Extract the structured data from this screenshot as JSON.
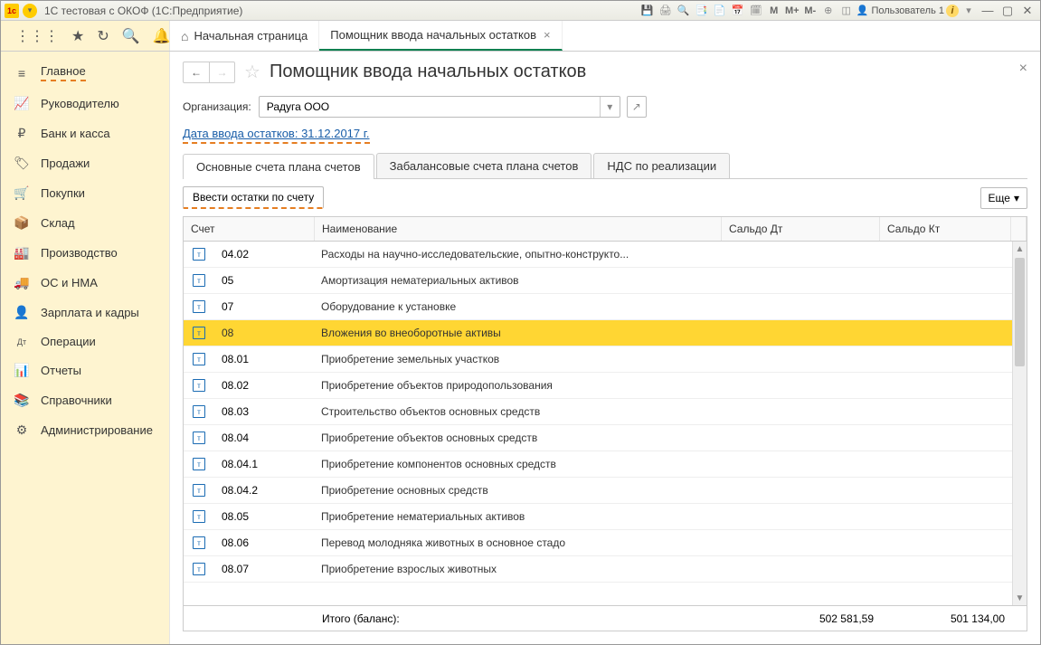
{
  "titlebar": {
    "title": "1С тестовая с ОКОФ (1С:Предприятие)",
    "user": "Пользователь 1",
    "icons": {
      "m": "M",
      "m_plus": "M+",
      "m_minus": "M-"
    }
  },
  "tabs": {
    "home": "Начальная страница",
    "current": "Помощник ввода начальных остатков"
  },
  "sidebar": [
    {
      "icon": "≡",
      "label": "Главное",
      "active": true
    },
    {
      "icon": "📈",
      "label": "Руководителю"
    },
    {
      "icon": "₽",
      "label": "Банк и касса"
    },
    {
      "icon": "🏷",
      "label": "Продажи"
    },
    {
      "icon": "🛒",
      "label": "Покупки"
    },
    {
      "icon": "📦",
      "label": "Склад"
    },
    {
      "icon": "🏭",
      "label": "Производство"
    },
    {
      "icon": "🚚",
      "label": "ОС и НМА"
    },
    {
      "icon": "👤",
      "label": "Зарплата и кадры"
    },
    {
      "icon": "Дт",
      "label": "Операции"
    },
    {
      "icon": "📊",
      "label": "Отчеты"
    },
    {
      "icon": "📚",
      "label": "Справочники"
    },
    {
      "icon": "⚙",
      "label": "Администрирование"
    }
  ],
  "page": {
    "title": "Помощник ввода начальных остатков",
    "org_label": "Организация:",
    "org_value": "Радуга ООО",
    "date_link": "Дата ввода остатков: 31.12.2017 г.",
    "inner_tabs": [
      "Основные счета плана счетов",
      "Забалансовые счета плана счетов",
      "НДС по реализации"
    ],
    "enter_balances_btn": "Ввести остатки по счету",
    "more_btn": "Еще",
    "columns": {
      "account": "Счет",
      "name": "Наименование",
      "saldo_dt": "Сальдо Дт",
      "saldo_kt": "Сальдо Кт"
    },
    "rows": [
      {
        "acct": "04.02",
        "name": "Расходы на научно-исследовательские, опытно-конструкто..."
      },
      {
        "acct": "05",
        "name": "Амортизация нематериальных активов"
      },
      {
        "acct": "07",
        "name": "Оборудование к установке"
      },
      {
        "acct": "08",
        "name": "Вложения во внеоборотные активы",
        "selected": true
      },
      {
        "acct": "08.01",
        "name": "Приобретение земельных участков"
      },
      {
        "acct": "08.02",
        "name": "Приобретение объектов природопользования"
      },
      {
        "acct": "08.03",
        "name": "Строительство объектов основных средств"
      },
      {
        "acct": "08.04",
        "name": "Приобретение объектов основных средств"
      },
      {
        "acct": "08.04.1",
        "name": "Приобретение компонентов основных средств"
      },
      {
        "acct": "08.04.2",
        "name": "Приобретение основных средств"
      },
      {
        "acct": "08.05",
        "name": "Приобретение нематериальных активов"
      },
      {
        "acct": "08.06",
        "name": "Перевод молодняка животных в основное стадо"
      },
      {
        "acct": "08.07",
        "name": "Приобретение взрослых животных"
      }
    ],
    "footer": {
      "label": "Итого (баланс):",
      "saldo_dt": "502 581,59",
      "saldo_kt": "501 134,00"
    }
  }
}
